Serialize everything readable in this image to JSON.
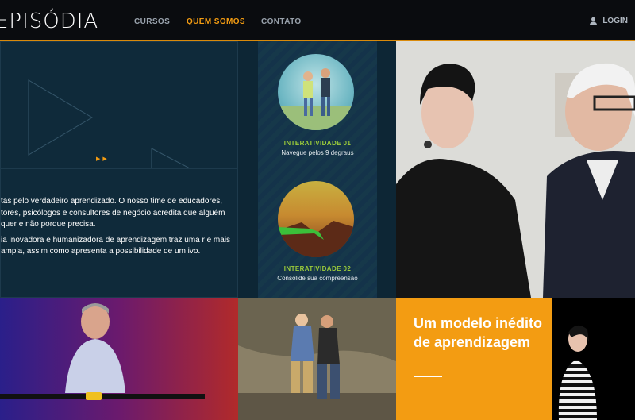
{
  "nav": {
    "logo": "EPISÓDIA",
    "items": [
      {
        "label": "CURSOS",
        "active": false
      },
      {
        "label": "QUEM SOMOS",
        "active": true
      },
      {
        "label": "CONTATO",
        "active": false
      }
    ],
    "login_label": "LOGIN",
    "accent_color": "#f39c12"
  },
  "about": {
    "paragraph1": "tas pelo verdadeiro aprendizado. O nosso time de educadores, tores, psicólogos e consultores de negócio acredita que alguém quer e não porque precisa.",
    "paragraph2": "ia inovadora e humanizadora de aprendizagem traz uma r e mais ampla, assim como apresenta a possibilidade de um ivo."
  },
  "interactivity": [
    {
      "title": "INTERATIVIDADE 01",
      "subtitle": "Navegue pelos 9 degraus"
    },
    {
      "title": "INTERATIVIDADE 02",
      "subtitle": "Consolide sua compreensão"
    }
  ],
  "promo": {
    "heading": "Um modelo inédito de aprendizagem"
  }
}
